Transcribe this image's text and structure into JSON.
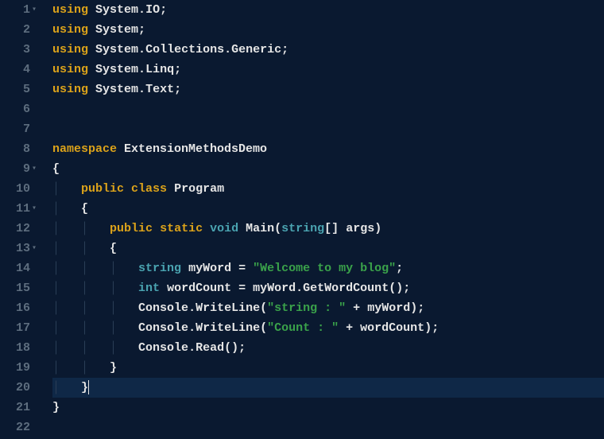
{
  "editor": {
    "language": "csharp",
    "highlight_line": 20,
    "lines": [
      {
        "n": 1,
        "fold": true,
        "indent": 0,
        "tokens": [
          [
            "kw-using",
            "using"
          ],
          [
            "plain",
            " "
          ],
          [
            "ident",
            "System"
          ],
          [
            "punct",
            "."
          ],
          [
            "ident",
            "IO"
          ],
          [
            "punct",
            ";"
          ]
        ]
      },
      {
        "n": 2,
        "fold": false,
        "indent": 0,
        "tokens": [
          [
            "kw-using",
            "using"
          ],
          [
            "plain",
            " "
          ],
          [
            "ident",
            "System"
          ],
          [
            "punct",
            ";"
          ]
        ]
      },
      {
        "n": 3,
        "fold": false,
        "indent": 0,
        "tokens": [
          [
            "kw-using",
            "using"
          ],
          [
            "plain",
            " "
          ],
          [
            "ident",
            "System"
          ],
          [
            "punct",
            "."
          ],
          [
            "ident",
            "Collections"
          ],
          [
            "punct",
            "."
          ],
          [
            "ident",
            "Generic"
          ],
          [
            "punct",
            ";"
          ]
        ]
      },
      {
        "n": 4,
        "fold": false,
        "indent": 0,
        "tokens": [
          [
            "kw-using",
            "using"
          ],
          [
            "plain",
            " "
          ],
          [
            "ident",
            "System"
          ],
          [
            "punct",
            "."
          ],
          [
            "ident",
            "Linq"
          ],
          [
            "punct",
            ";"
          ]
        ]
      },
      {
        "n": 5,
        "fold": false,
        "indent": 0,
        "tokens": [
          [
            "kw-using",
            "using"
          ],
          [
            "plain",
            " "
          ],
          [
            "ident",
            "System"
          ],
          [
            "punct",
            "."
          ],
          [
            "ident",
            "Text"
          ],
          [
            "punct",
            ";"
          ]
        ]
      },
      {
        "n": 6,
        "fold": false,
        "indent": 0,
        "tokens": []
      },
      {
        "n": 7,
        "fold": false,
        "indent": 0,
        "tokens": []
      },
      {
        "n": 8,
        "fold": false,
        "indent": 0,
        "tokens": [
          [
            "kw-ns",
            "namespace"
          ],
          [
            "plain",
            " "
          ],
          [
            "ident",
            "ExtensionMethodsDemo"
          ]
        ]
      },
      {
        "n": 9,
        "fold": true,
        "indent": 0,
        "tokens": [
          [
            "brace",
            "{"
          ]
        ]
      },
      {
        "n": 10,
        "fold": false,
        "indent": 1,
        "tokens": [
          [
            "kw-mod",
            "public"
          ],
          [
            "plain",
            " "
          ],
          [
            "kw-mod",
            "class"
          ],
          [
            "plain",
            " "
          ],
          [
            "ident",
            "Program"
          ]
        ]
      },
      {
        "n": 11,
        "fold": true,
        "indent": 1,
        "tokens": [
          [
            "brace",
            "{"
          ]
        ]
      },
      {
        "n": 12,
        "fold": false,
        "indent": 2,
        "tokens": [
          [
            "kw-mod",
            "public"
          ],
          [
            "plain",
            " "
          ],
          [
            "kw-mod",
            "static"
          ],
          [
            "plain",
            " "
          ],
          [
            "kw-void",
            "void"
          ],
          [
            "plain",
            " "
          ],
          [
            "method",
            "Main"
          ],
          [
            "punct",
            "("
          ],
          [
            "kw-type",
            "string"
          ],
          [
            "punct",
            "[] "
          ],
          [
            "ident",
            "args"
          ],
          [
            "punct",
            ")"
          ]
        ]
      },
      {
        "n": 13,
        "fold": true,
        "indent": 2,
        "tokens": [
          [
            "brace",
            "{"
          ]
        ]
      },
      {
        "n": 14,
        "fold": false,
        "indent": 3,
        "tokens": [
          [
            "kw-type",
            "string"
          ],
          [
            "plain",
            " "
          ],
          [
            "ident",
            "myWord"
          ],
          [
            "plain",
            " "
          ],
          [
            "punct",
            "="
          ],
          [
            "plain",
            " "
          ],
          [
            "string",
            "\"Welcome to my blog\""
          ],
          [
            "punct",
            ";"
          ]
        ]
      },
      {
        "n": 15,
        "fold": false,
        "indent": 3,
        "tokens": [
          [
            "kw-type",
            "int"
          ],
          [
            "plain",
            " "
          ],
          [
            "ident",
            "wordCount"
          ],
          [
            "plain",
            " "
          ],
          [
            "punct",
            "="
          ],
          [
            "plain",
            " "
          ],
          [
            "ident",
            "myWord"
          ],
          [
            "punct",
            "."
          ],
          [
            "method",
            "GetWordCount"
          ],
          [
            "punct",
            "();"
          ]
        ]
      },
      {
        "n": 16,
        "fold": false,
        "indent": 3,
        "tokens": [
          [
            "ident",
            "Console"
          ],
          [
            "punct",
            "."
          ],
          [
            "method",
            "WriteLine"
          ],
          [
            "punct",
            "("
          ],
          [
            "string",
            "\"string : \""
          ],
          [
            "plain",
            " "
          ],
          [
            "punct",
            "+"
          ],
          [
            "plain",
            " "
          ],
          [
            "ident",
            "myWord"
          ],
          [
            "punct",
            ");"
          ]
        ]
      },
      {
        "n": 17,
        "fold": false,
        "indent": 3,
        "tokens": [
          [
            "ident",
            "Console"
          ],
          [
            "punct",
            "."
          ],
          [
            "method",
            "WriteLine"
          ],
          [
            "punct",
            "("
          ],
          [
            "string",
            "\"Count : \""
          ],
          [
            "plain",
            " "
          ],
          [
            "punct",
            "+"
          ],
          [
            "plain",
            " "
          ],
          [
            "ident",
            "wordCount"
          ],
          [
            "punct",
            ");"
          ]
        ]
      },
      {
        "n": 18,
        "fold": false,
        "indent": 3,
        "tokens": [
          [
            "ident",
            "Console"
          ],
          [
            "punct",
            "."
          ],
          [
            "method",
            "Read"
          ],
          [
            "punct",
            "();"
          ]
        ]
      },
      {
        "n": 19,
        "fold": false,
        "indent": 2,
        "tokens": [
          [
            "brace",
            "}"
          ]
        ]
      },
      {
        "n": 20,
        "fold": false,
        "indent": 1,
        "tokens": [
          [
            "brace",
            "}"
          ]
        ],
        "cursor_after": true
      },
      {
        "n": 21,
        "fold": false,
        "indent": 0,
        "tokens": [
          [
            "brace",
            "}"
          ]
        ]
      },
      {
        "n": 22,
        "fold": false,
        "indent": 0,
        "tokens": []
      }
    ]
  }
}
